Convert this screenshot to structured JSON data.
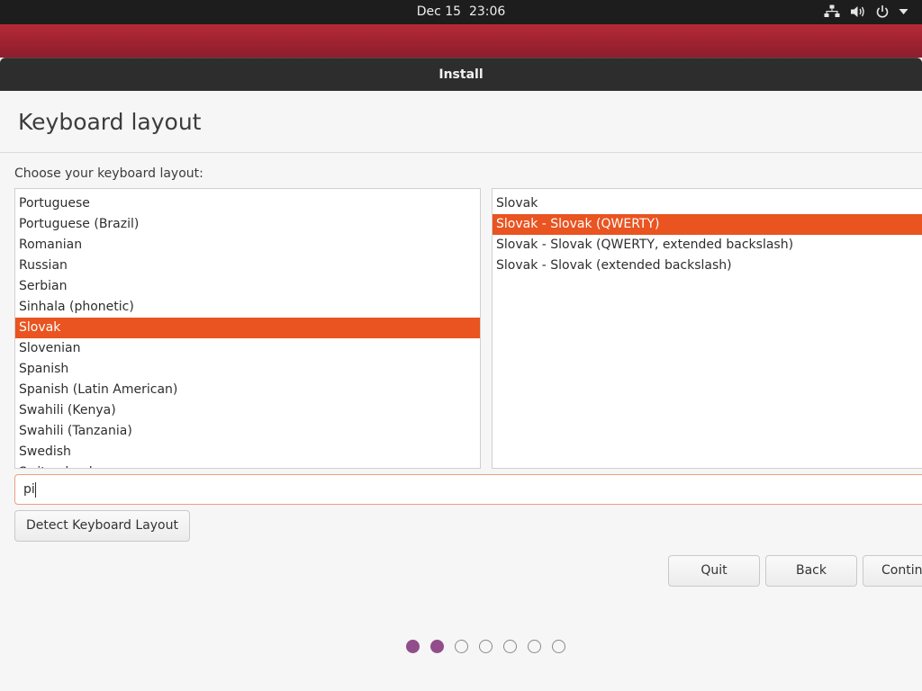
{
  "topbar": {
    "clock": "Dec 15  23:06",
    "icons": [
      "network-icon",
      "volume-icon",
      "power-icon",
      "chevron-down-icon"
    ]
  },
  "window": {
    "title": "Install"
  },
  "page": {
    "title": "Keyboard layout",
    "choose_label": "Choose your keyboard layout:"
  },
  "layouts": {
    "items": [
      "Portuguese",
      "Portuguese (Brazil)",
      "Romanian",
      "Russian",
      "Serbian",
      "Sinhala (phonetic)",
      "Slovak",
      "Slovenian",
      "Spanish",
      "Spanish (Latin American)",
      "Swahili (Kenya)",
      "Swahili (Tanzania)",
      "Swedish",
      "Switzerland"
    ],
    "selected": "Slovak"
  },
  "variants": {
    "items": [
      "Slovak",
      "Slovak - Slovak (QWERTY)",
      "Slovak - Slovak (QWERTY, extended backslash)",
      "Slovak - Slovak (extended backslash)"
    ],
    "selected": "Slovak - Slovak (QWERTY)"
  },
  "test_input": {
    "value": "pi"
  },
  "buttons": {
    "detect": "Detect Keyboard Layout",
    "quit": "Quit",
    "back": "Back",
    "continue": "Continue"
  },
  "progress": {
    "total_steps": 7,
    "completed_steps": 2
  },
  "colors": {
    "accent": "#e95420",
    "progress_dot": "#924d8b",
    "desktop": "#9e2230"
  }
}
